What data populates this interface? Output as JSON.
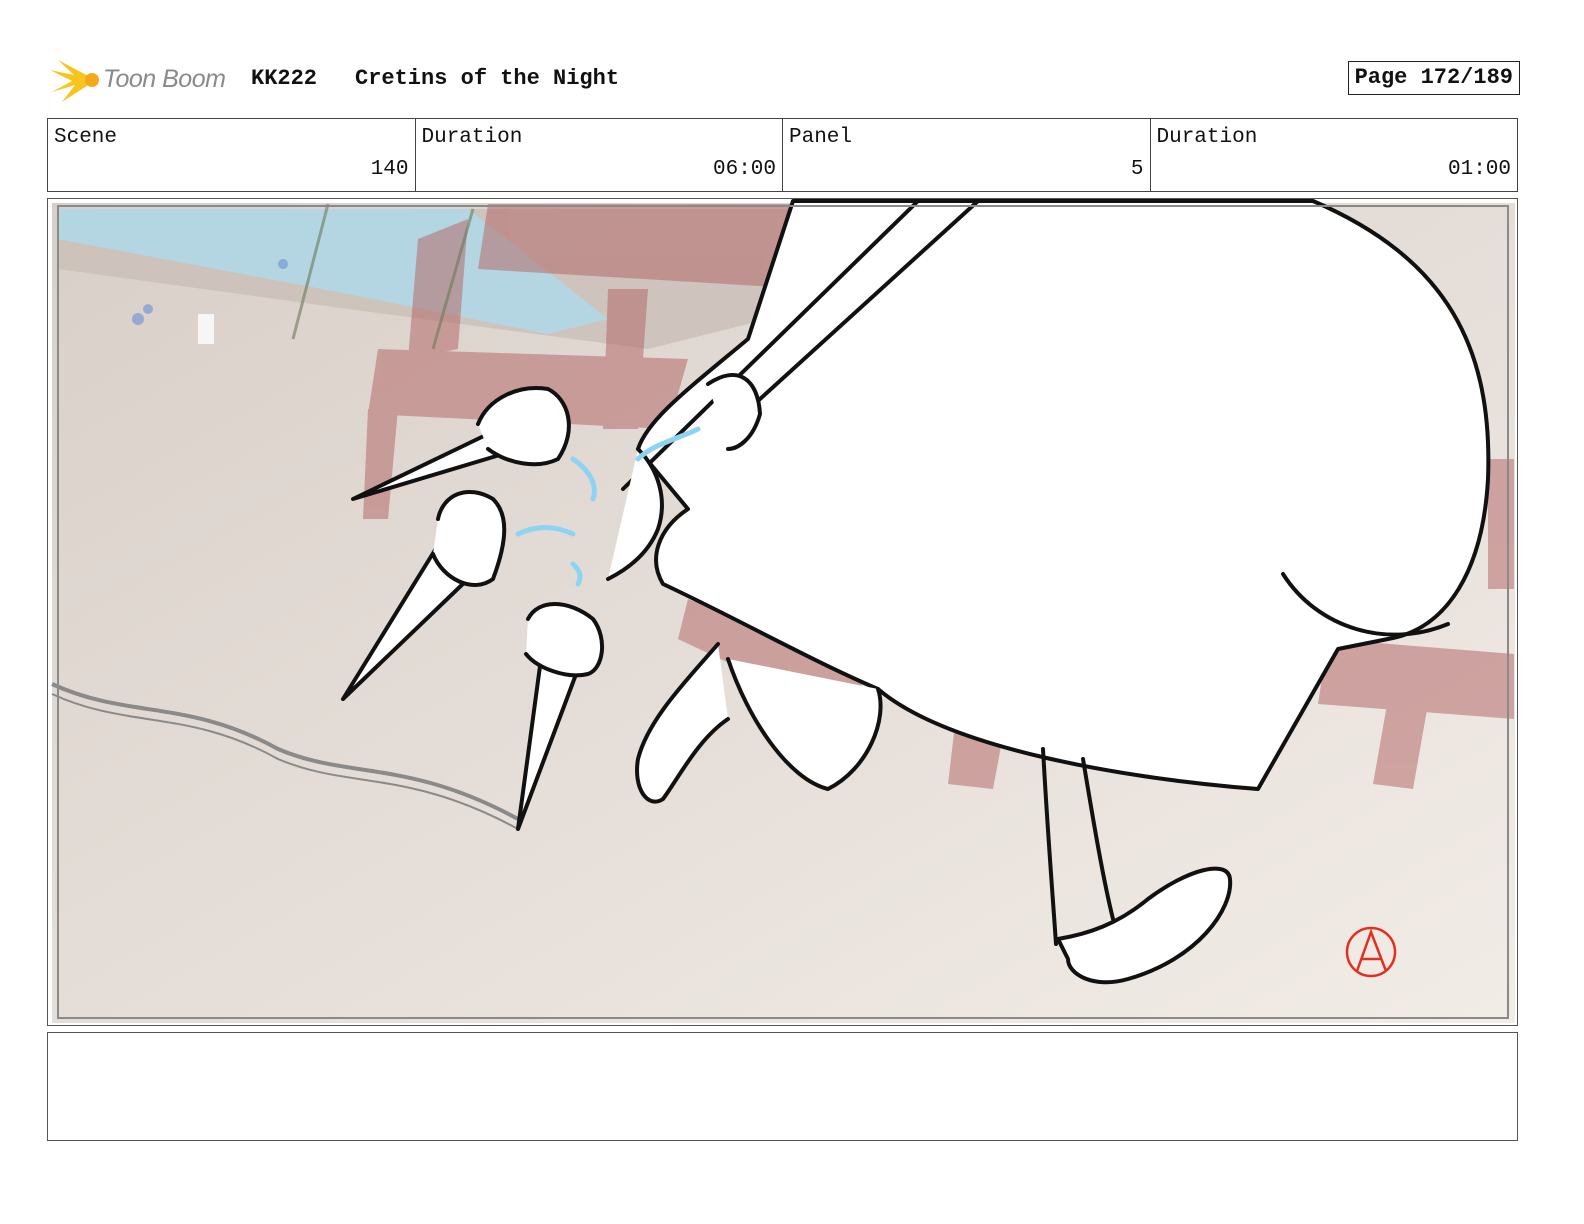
{
  "header": {
    "logo_text": "Toon Boom",
    "project_code": "KK222",
    "project_title": "Cretins of the Night",
    "page_label": "Page 172/189"
  },
  "info": [
    {
      "label": "Scene",
      "value": "140"
    },
    {
      "label": "Duration",
      "value": "06:00"
    },
    {
      "label": "Panel",
      "value": "5"
    },
    {
      "label": "Duration",
      "value": "01:00"
    }
  ],
  "panel": {
    "image_name": "storyboard-panel-drawing",
    "signature_mark": "A"
  },
  "notes": {
    "text": ""
  },
  "colors": {
    "logo_accent": "#f7c51e",
    "signature": "#e03020",
    "line_art": "#111111",
    "highlight": "#8fd3f4",
    "background_props": "#b56b6b"
  }
}
